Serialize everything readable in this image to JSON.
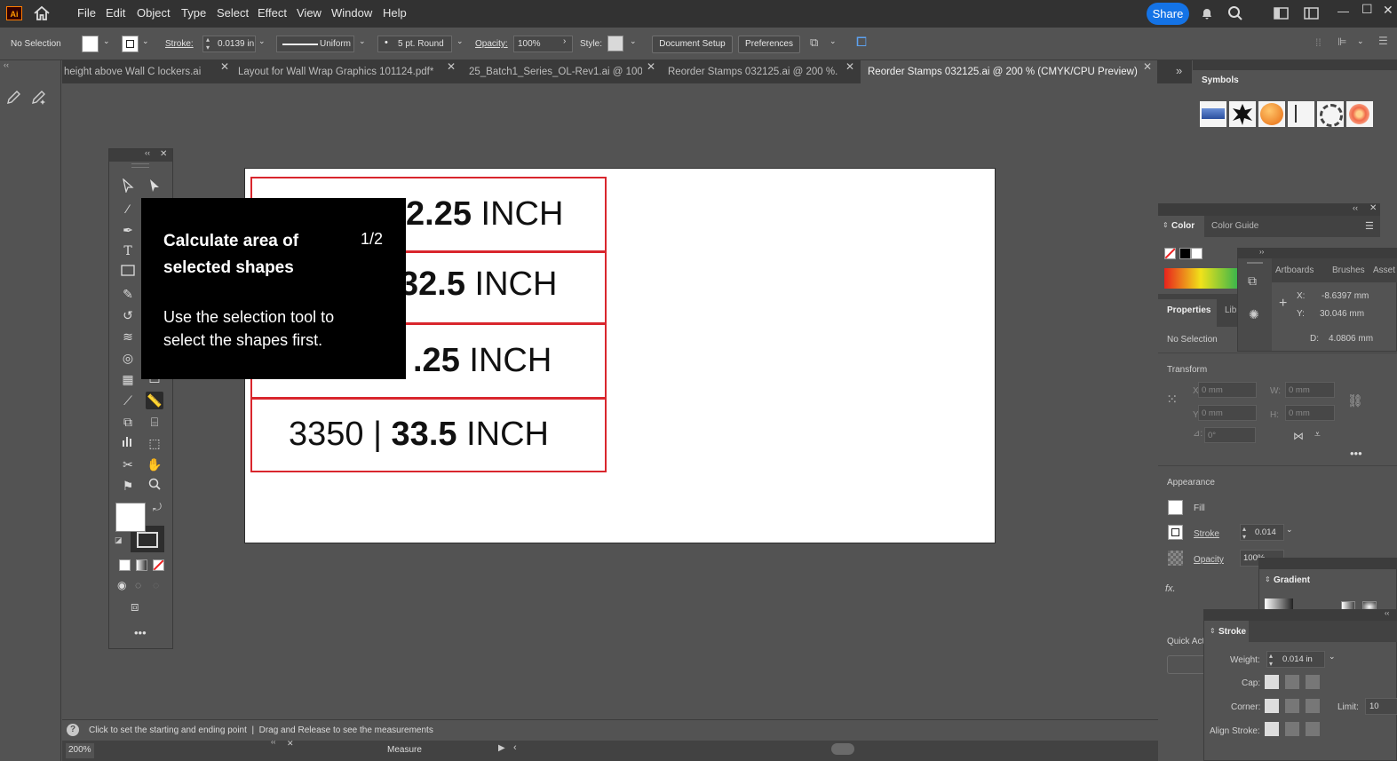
{
  "menubar": {
    "logo": "Ai",
    "items": [
      "File",
      "Edit",
      "Object",
      "Type",
      "Select",
      "Effect",
      "View",
      "Window",
      "Help"
    ],
    "share_label": "Share"
  },
  "control": {
    "selection": "No Selection",
    "stroke_label": "Stroke:",
    "stroke_value": "0.0139 in",
    "profile": "Uniform",
    "brush": "5 pt. Round",
    "opacity_label": "Opacity:",
    "opacity_value": "100%",
    "style_label": "Style:",
    "doc_setup": "Document Setup",
    "preferences": "Preferences"
  },
  "tabs": [
    {
      "label": "height above Wall C lockers.ai"
    },
    {
      "label": "Layout for Wall Wrap Graphics 101124.pdf*"
    },
    {
      "label": "25_Batch1_Series_OL-Rev1.ai @ 100..."
    },
    {
      "label": "Reorder Stamps 032125.ai @ 200 %..."
    },
    {
      "label": "Reorder Stamps 032125.ai @ 200 % (CMYK/CPU Preview)"
    }
  ],
  "artboard": {
    "rows": [
      {
        "left": "",
        "bold": "2.25",
        "unit": "INCH"
      },
      {
        "left": "",
        "bold": "32.5",
        "unit": "INCH"
      },
      {
        "left": "",
        "bold": ".25",
        "unit": "INCH"
      },
      {
        "left": "3350",
        "bold": "33.5",
        "unit": "INCH"
      }
    ]
  },
  "tooltip": {
    "title": "Calculate area of selected shapes",
    "step": "1/2",
    "body": "Use the selection tool to select the shapes first."
  },
  "symbols": {
    "title": "Symbols"
  },
  "color_panel": {
    "tab_color": "Color",
    "tab_guide": "Color Guide"
  },
  "artboards_panel": {
    "tabs": [
      "Artboards",
      "Brushes",
      "Asset"
    ],
    "x_label": "X:",
    "x_value": "-8.6397 mm",
    "y_label": "Y:",
    "y_value": "30.046 mm",
    "d_label": "D:",
    "d_value": "4.0806 mm"
  },
  "properties": {
    "tab": "Properties",
    "tab2": "Lib",
    "selection": "No Selection",
    "transform": "Transform",
    "x_label": "X:",
    "x_value": "0 mm",
    "y_label": "Y:",
    "y_value": "0 mm",
    "w_label": "W:",
    "w_value": "0 mm",
    "h_label": "H:",
    "h_value": "0 mm",
    "angle_value": "0°",
    "appearance": "Appearance",
    "fill": "Fill",
    "stroke": "Stroke",
    "stroke_value": "0.014",
    "opacity": "Opacity",
    "opacity_value": "100%",
    "fx": "fx.",
    "quick_actions": "Quick Act"
  },
  "gradient": {
    "title": "Gradient"
  },
  "stroke_panel": {
    "title": "Stroke",
    "weight_label": "Weight:",
    "weight_value": "0.014 in",
    "cap_label": "Cap:",
    "corner_label": "Corner:",
    "limit_label": "Limit:",
    "limit_value": "10",
    "align_label": "Align Stroke:"
  },
  "status": {
    "hint": "Click to set the starting and ending point  |  Drag and Release to see the measurements",
    "zoom": "200%",
    "tool": "Measure"
  }
}
